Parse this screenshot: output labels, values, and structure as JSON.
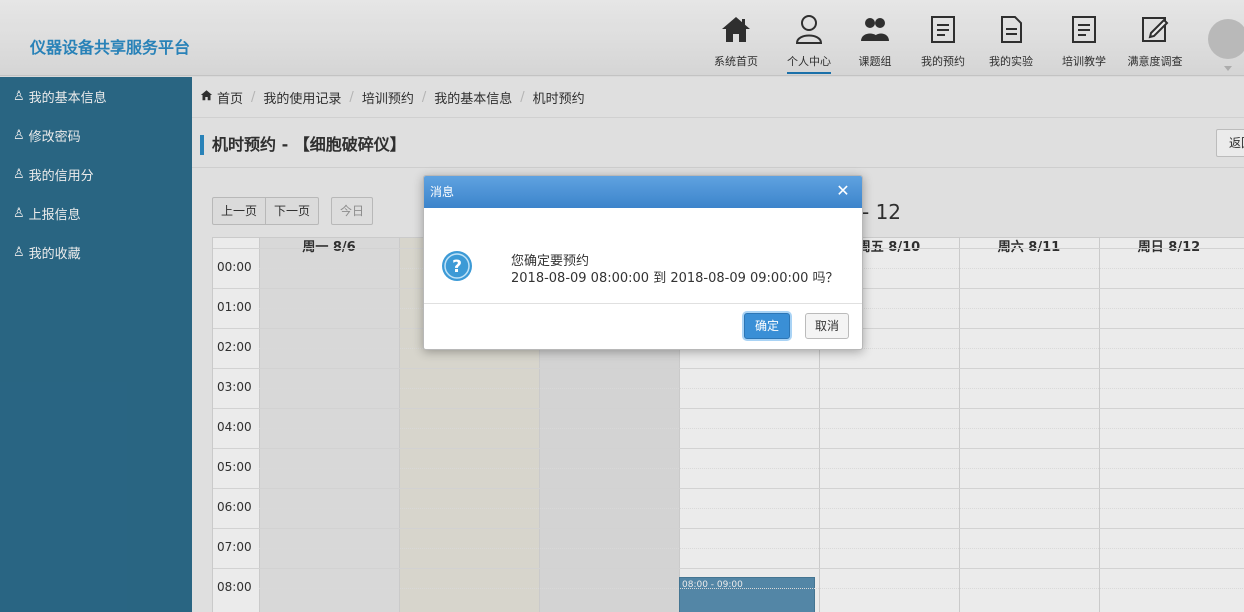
{
  "app_title": "仪器设备共享服务平台",
  "nav": [
    {
      "label": "系统首页",
      "icon": "home-icon"
    },
    {
      "label": "个人中心",
      "icon": "user-icon",
      "active": true
    },
    {
      "label": "课题组",
      "icon": "group-icon"
    },
    {
      "label": "我的预约",
      "icon": "clipboard-icon"
    },
    {
      "label": "我的实验",
      "icon": "document-icon"
    },
    {
      "label": "培训教学",
      "icon": "clipboard-icon"
    },
    {
      "label": "满意度调查",
      "icon": "edit-icon"
    }
  ],
  "sidebar": {
    "items": [
      {
        "label": "我的基本信息"
      },
      {
        "label": "修改密码"
      },
      {
        "label": "我的信用分"
      },
      {
        "label": "上报信息"
      },
      {
        "label": "我的收藏"
      }
    ]
  },
  "breadcrumb": [
    "首页",
    "我的使用记录",
    "培训预约",
    "我的基本信息",
    "机时预约"
  ],
  "page_title": "机时预约 - 【细胞破碎仪】",
  "back_label": "返回",
  "toolbar": {
    "prev": "上一页",
    "next": "下一页",
    "today": "今日"
  },
  "date_range": "- 12",
  "calendar": {
    "day_headers": [
      {
        "label": "周一 8/6",
        "col": 0
      },
      {
        "label": "周五 8/10",
        "col": 4
      },
      {
        "label": "周六 8/11",
        "col": 5
      },
      {
        "label": "周日 8/12",
        "col": 6
      }
    ],
    "times": [
      "00:00",
      "01:00",
      "02:00",
      "03:00",
      "04:00",
      "05:00",
      "06:00",
      "07:00",
      "08:00"
    ],
    "event_label": "08:00 - 09:00"
  },
  "dialog": {
    "title": "消息",
    "line1": "您确定要预约",
    "line2": "2018-08-09 08:00:00 到 2018-08-09 09:00:00 吗？",
    "ok": "确定",
    "cancel": "取消"
  },
  "colors": {
    "accent": "#2d8ec8",
    "sidebar": "#2d6e8e",
    "dialog_header": "#4a90d0"
  }
}
